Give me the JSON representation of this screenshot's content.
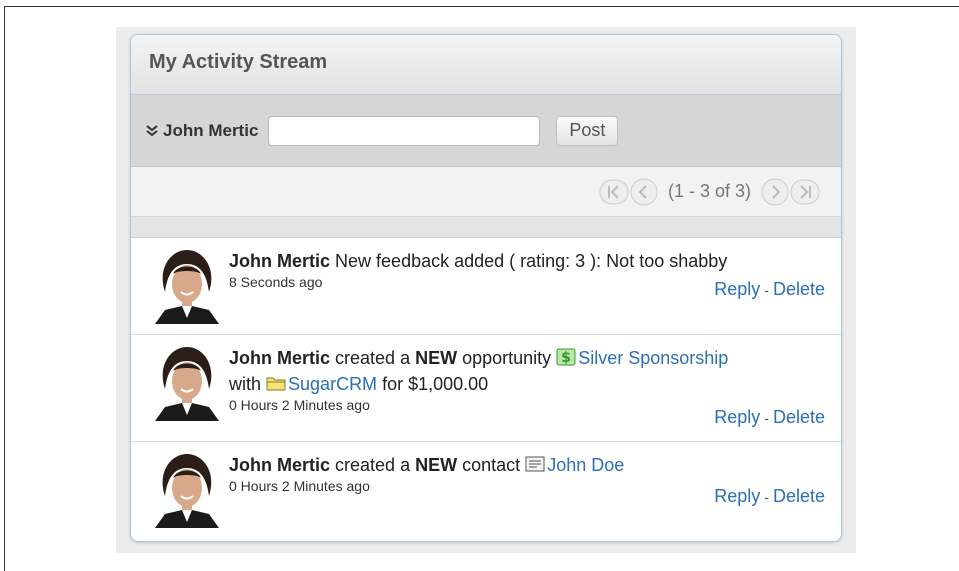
{
  "dashlet": {
    "title": "My Activity Stream"
  },
  "post": {
    "user": "John Mertic",
    "input_value": "",
    "button": "Post"
  },
  "pager": {
    "text": "(1 - 3 of 3)"
  },
  "items": [
    {
      "user": "John Mertic",
      "text": "New feedback added ( rating: 3 ): Not too shabby",
      "ago": "8 Seconds ago",
      "reply": "Reply",
      "sep": "-",
      "delete": "Delete"
    },
    {
      "user": "John Mertic",
      "pre": "created a",
      "new": "NEW",
      "type": "opportunity",
      "link1": "Silver Sponsorship",
      "with": "with",
      "link2": "SugarCRM",
      "amount": "for $1,000.00",
      "ago": "0 Hours 2 Minutes ago",
      "reply": "Reply",
      "sep": "-",
      "delete": "Delete"
    },
    {
      "user": "John Mertic",
      "pre": "created a",
      "new": "NEW",
      "type": "contact",
      "link1": "John Doe",
      "ago": "0 Hours 2 Minutes ago",
      "reply": "Reply",
      "sep": "-",
      "delete": "Delete"
    }
  ],
  "icons": {
    "expand": "double-chevron-down-icon",
    "opportunity": "money-icon",
    "account": "folder-icon",
    "contact": "contact-card-icon"
  },
  "colors": {
    "link": "#2a6fb7",
    "border": "#a9c6e0",
    "icon_green": "#2e9a2e"
  }
}
